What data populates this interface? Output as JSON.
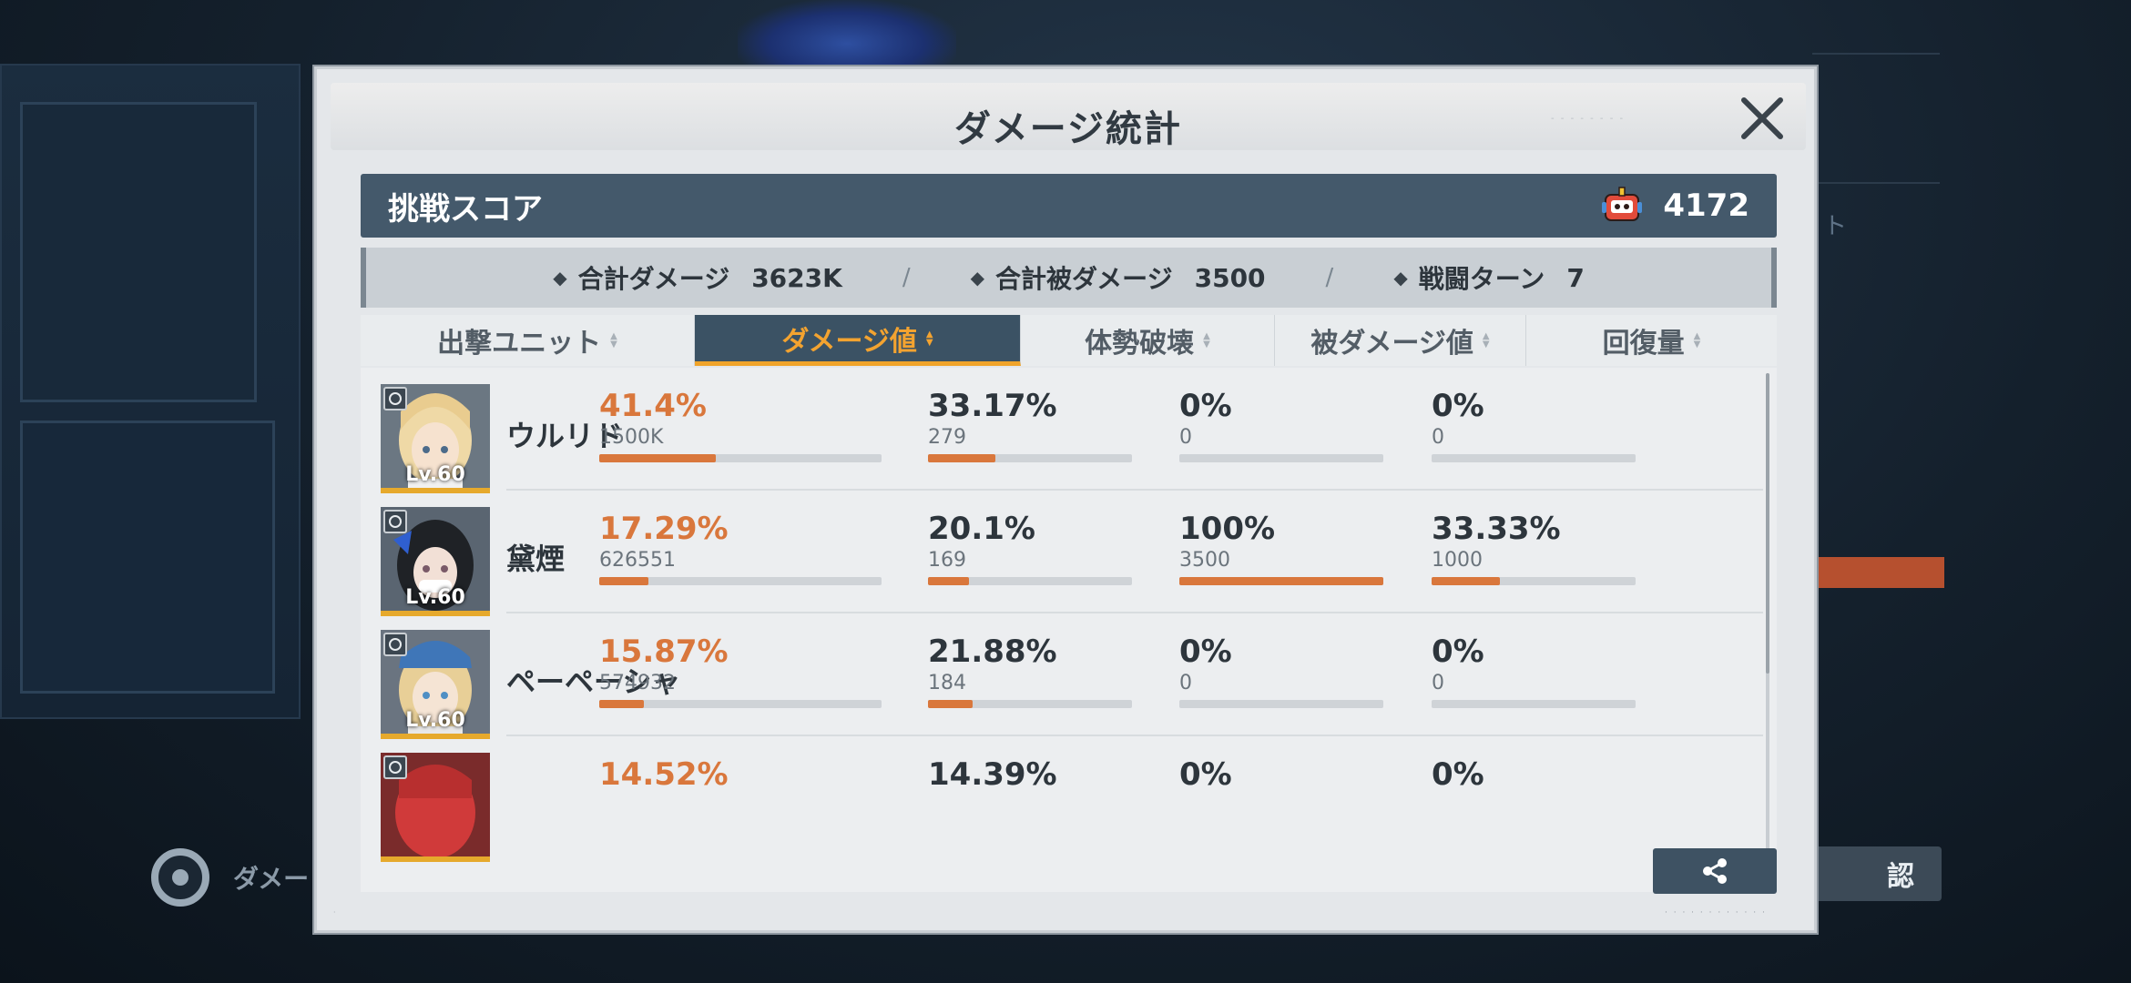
{
  "modal": {
    "title": "ダメージ統計"
  },
  "score": {
    "label": "挑戦スコア",
    "value": "4172",
    "icon": "robot-mascot-icon"
  },
  "summary": {
    "total_damage_label": "合計ダメージ",
    "total_damage_value": "3623K",
    "total_taken_label": "合計被ダメージ",
    "total_taken_value": "3500",
    "turns_label": "戦闘ターン",
    "turns_value": "7",
    "separator": "/"
  },
  "tabs": [
    {
      "label": "出撃ユニット",
      "active": false
    },
    {
      "label": "ダメージ値",
      "active": true
    },
    {
      "label": "体勢破壊",
      "active": false
    },
    {
      "label": "被ダメージ値",
      "active": false
    },
    {
      "label": "回復量",
      "active": false
    }
  ],
  "rows": [
    {
      "name": "ウルリド",
      "level": "Lv.60",
      "damage": {
        "pct": "41.4%",
        "value": "1500K",
        "fraction": 0.414
      },
      "break": {
        "pct": "33.17%",
        "value": "279",
        "fraction": 0.3317
      },
      "taken": {
        "pct": "0%",
        "value": "0",
        "fraction": 0
      },
      "heal": {
        "pct": "0%",
        "value": "0",
        "fraction": 0
      }
    },
    {
      "name": "黛煙",
      "level": "Lv.60",
      "damage": {
        "pct": "17.29%",
        "value": "626551",
        "fraction": 0.1729
      },
      "break": {
        "pct": "20.1%",
        "value": "169",
        "fraction": 0.201
      },
      "taken": {
        "pct": "100%",
        "value": "3500",
        "fraction": 1.0
      },
      "heal": {
        "pct": "33.33%",
        "value": "1000",
        "fraction": 0.3333
      }
    },
    {
      "name": "ペーペーシャ",
      "level": "Lv.60",
      "damage": {
        "pct": "15.87%",
        "value": "574932",
        "fraction": 0.1587
      },
      "break": {
        "pct": "21.88%",
        "value": "184",
        "fraction": 0.2188
      },
      "taken": {
        "pct": "0%",
        "value": "0",
        "fraction": 0
      },
      "heal": {
        "pct": "0%",
        "value": "0",
        "fraction": 0
      }
    },
    {
      "name": "",
      "level": "",
      "damage": {
        "pct": "14.52%",
        "value": "",
        "fraction": 0.1452
      },
      "break": {
        "pct": "14.39%",
        "value": "",
        "fraction": 0.1439
      },
      "taken": {
        "pct": "0%",
        "value": "",
        "fraction": 0
      },
      "heal": {
        "pct": "0%",
        "value": "",
        "fraction": 0
      }
    }
  ],
  "background": {
    "bottom_left_label": "ダメー",
    "right_button_label": "認",
    "right_text": "ト"
  },
  "colors": {
    "accent_orange": "#d9773c",
    "tab_active_bg": "#3b5264",
    "tab_active_text": "#f3a330",
    "score_bar_bg": "#44596b"
  }
}
